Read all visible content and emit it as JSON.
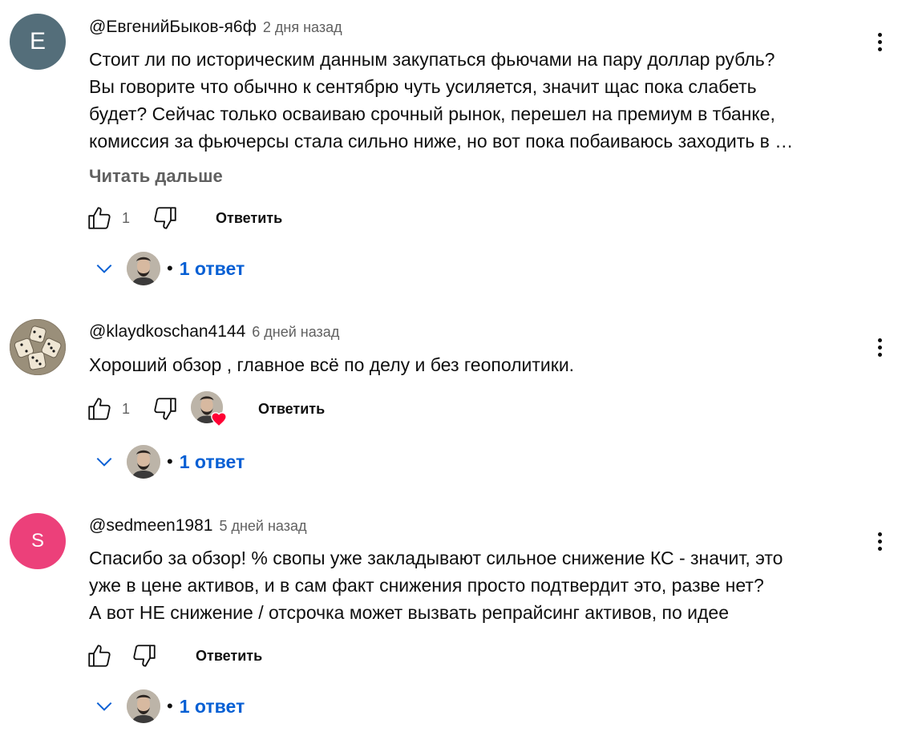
{
  "comments": [
    {
      "avatar_letter": "E",
      "avatar_color": "#546e7a",
      "author": "@ЕвгенийБыков-я6ф",
      "time": "2 дня назад",
      "lines": [
        "Стоит ли по историческим данным закупаться фьючами на пару доллар рубль?",
        "Вы говорите что обычно к сентябрю чуть усиляется, значит щас пока слабеть",
        "будет? Сейчас только осваиваю срочный рынок, перешел на премиум в тбанке,",
        "комиссия за фьючерсы стала сильно ниже, но вот пока побаиваюсь заходить в …"
      ],
      "read_more": "Читать дальше",
      "likes": "1",
      "reply_label": "Ответить",
      "replies_label": "1 ответ"
    },
    {
      "avatar_letter": "",
      "avatar_color": "#7a7060",
      "author": "@klaydkoschan4144",
      "time": "6 дней назад",
      "lines": [
        "Хороший обзор , главное всё по делу и без геополитики."
      ],
      "likes": "1",
      "reply_label": "Ответить",
      "replies_label": "1 ответ"
    },
    {
      "avatar_letter": "S",
      "avatar_color": "#ec407a",
      "author": "@sedmeen1981",
      "time": "5 дней назад",
      "lines": [
        "Спасибо за обзор! % свопы уже закладывают сильное снижение КС - значит, это",
        "уже в цене активов, и в сам факт снижения просто подтвердит это, разве нет?",
        "А вот НЕ снижение / отсрочка может вызвать репрайсинг активов, по идее"
      ],
      "likes": "",
      "reply_label": "Ответить",
      "replies_label": "1 ответ"
    }
  ],
  "icons": {
    "like": "thumb-up-icon",
    "dislike": "thumb-down-icon",
    "menu": "more-vertical-icon",
    "expand": "chevron-down-icon",
    "heart": "heart-icon"
  },
  "colors": {
    "link_blue": "#065fd4",
    "secondary_text": "#606060",
    "heart_red": "#ff0033"
  }
}
